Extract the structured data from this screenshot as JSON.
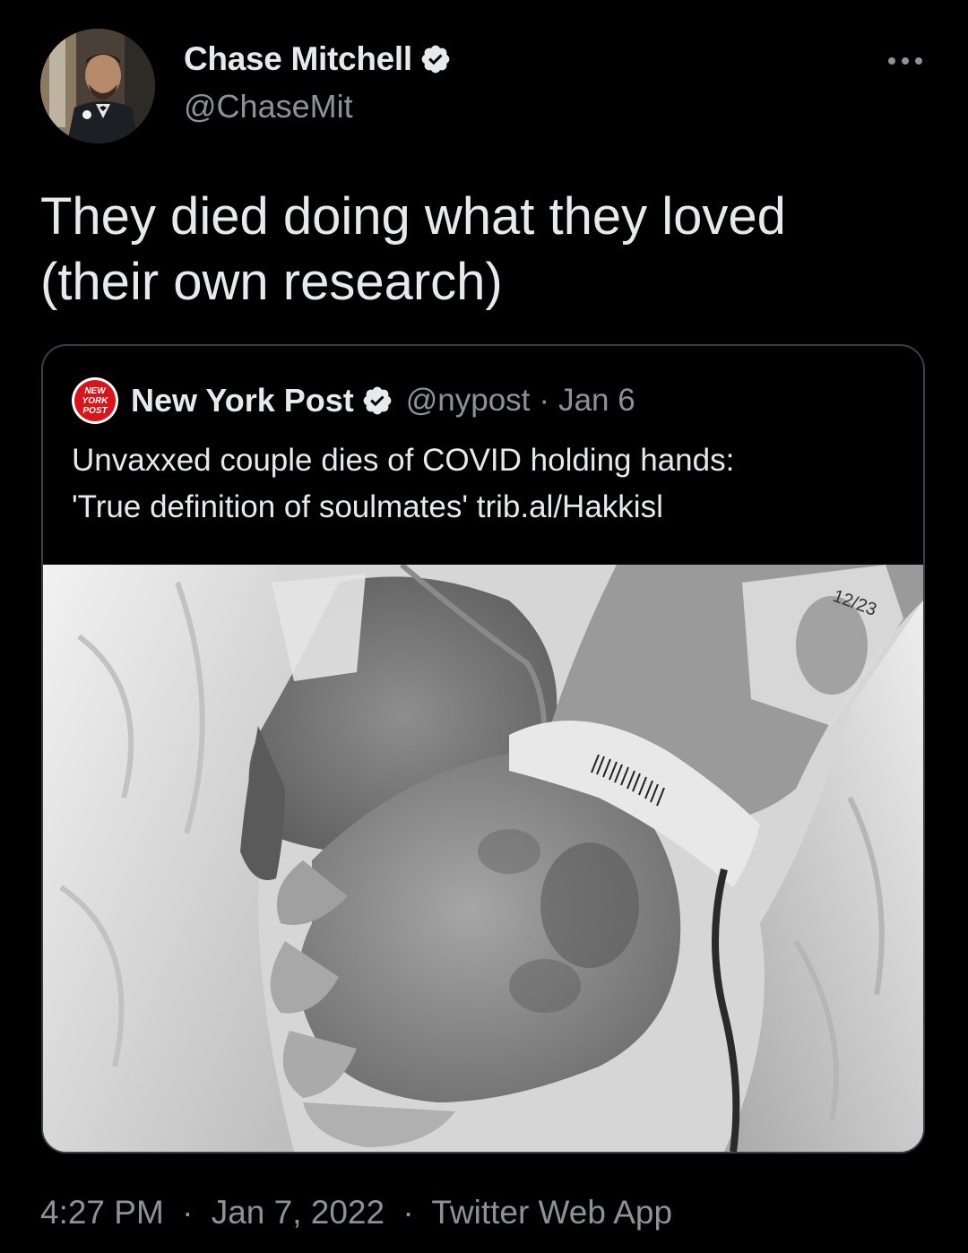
{
  "author": {
    "display_name": "Chase Mitchell",
    "handle": "@ChaseMit",
    "verified": true
  },
  "tweet": {
    "text_lines": [
      "They died doing what they loved",
      "(their own research)"
    ]
  },
  "quoted_tweet": {
    "logo_text": [
      "NEW",
      "YORK",
      "POST"
    ],
    "display_name": "New York Post",
    "handle": "@nypost",
    "separator": "·",
    "date": "Jan 6",
    "text_lines": [
      "Unvaxxed couple dies of COVID holding hands:",
      "'True definition of soulmates' trib.al/Hakkisl"
    ],
    "image_stamp": "12/23"
  },
  "footer": {
    "time": "4:27 PM",
    "date": "Jan 7, 2022",
    "source": "Twitter Web App",
    "separator": "·"
  },
  "colors": {
    "background": "#000000",
    "primary_text": "#e7e9ea",
    "secondary_text": "#8b9299",
    "card_border": "#3a3f44",
    "nypost_red": "#d9141b"
  }
}
